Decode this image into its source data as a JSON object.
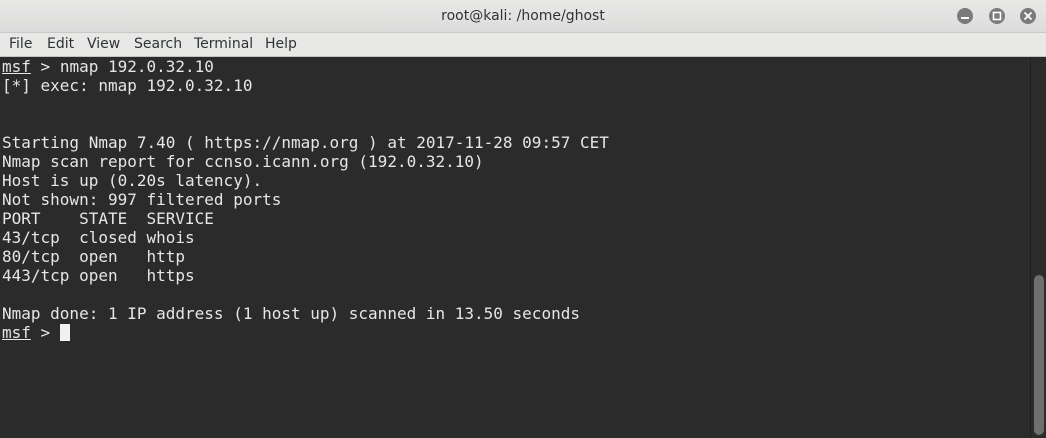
{
  "window": {
    "title": "root@kali: /home/ghost"
  },
  "menu": {
    "items": [
      "File",
      "Edit",
      "View",
      "Search",
      "Terminal",
      "Help"
    ]
  },
  "terminal": {
    "prompt_word": "msf",
    "prompt_sep": " > ",
    "command": "nmap 192.0.32.10",
    "exec_line": "[*] exec: nmap 192.0.32.10",
    "output": [
      "Starting Nmap 7.40 ( https://nmap.org ) at 2017-11-28 09:57 CET",
      "Nmap scan report for ccnso.icann.org (192.0.32.10)",
      "Host is up (0.20s latency).",
      "Not shown: 997 filtered ports",
      "PORT    STATE  SERVICE",
      "43/tcp  closed whois",
      "80/tcp  open   http",
      "443/tcp open   https"
    ],
    "done_line": "Nmap done: 1 IP address (1 host up) scanned in 13.50 seconds"
  },
  "colors": {
    "terminal_bg": "#2b2b2b",
    "terminal_fg": "#e6e6e6",
    "titlebar_bg": "#e8e8e7"
  },
  "icons": {
    "minimize": "minimize-icon",
    "maximize": "maximize-icon",
    "close": "close-icon"
  }
}
